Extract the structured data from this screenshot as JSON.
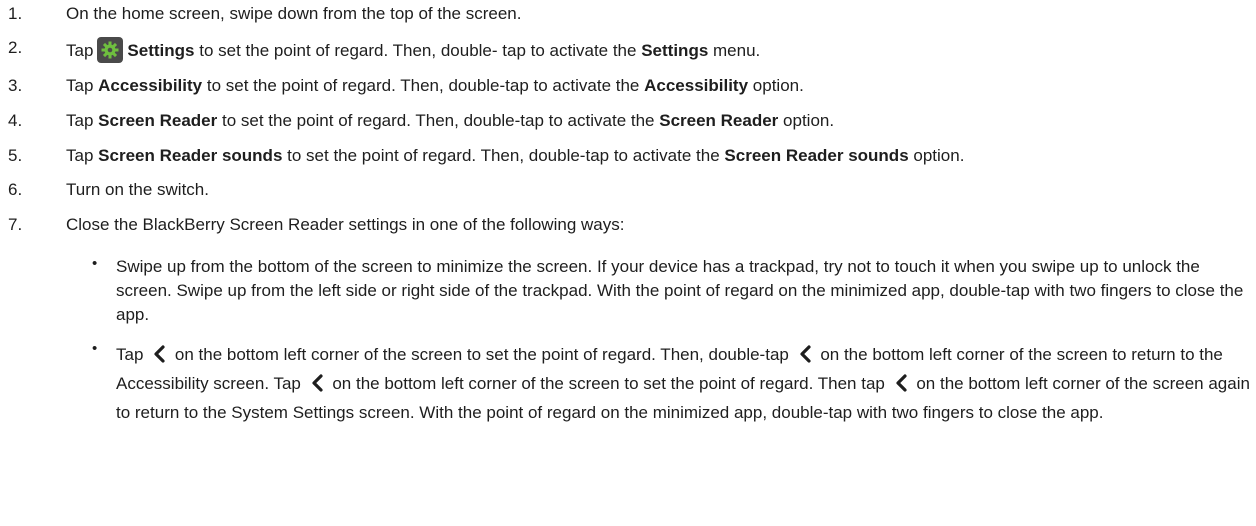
{
  "steps": [
    {
      "num": "1.",
      "text": "On the home screen, swipe down from the top of the screen."
    },
    {
      "num": "2.",
      "t1": "Tap",
      "b1": "Settings",
      "t2": "to set the point of regard. Then, double- tap to activate the",
      "b2": "Settings",
      "t3": "menu."
    },
    {
      "num": "3.",
      "t1": "Tap",
      "b1": "Accessibility",
      "t2": "to set the point of regard. Then, double-tap to activate the",
      "b2": "Accessibility",
      "t3": "option."
    },
    {
      "num": "4.",
      "t1": "Tap",
      "b1": "Screen Reader",
      "t2": "to set the point of regard. Then, double-tap to activate the",
      "b2": "Screen Reader",
      "t3": "option."
    },
    {
      "num": "5.",
      "t1": "Tap",
      "b1": "Screen Reader sounds",
      "t2": "to set the point of regard. Then, double-tap to activate the",
      "b2": "Screen Reader sounds",
      "t3": "option."
    },
    {
      "num": "6.",
      "text": "Turn on the switch."
    },
    {
      "num": "7.",
      "text": "Close the BlackBerry Screen Reader settings in one of the following ways:"
    }
  ],
  "bullets": {
    "marker": "•",
    "b1": "Swipe up from the bottom of the screen to minimize the screen. If your device has a trackpad, try not to touch it when you swipe up to unlock the screen. Swipe up from the left side or right side of the trackpad. With the point of regard on the minimized app, double-tap with two fingers to close the app.",
    "b2": {
      "p1": "Tap",
      "p2": "on the bottom left corner of the screen to set the point of regard. Then, double-tap",
      "p3": "on the bottom left corner of the screen to return to the Accessibility screen. Tap",
      "p4": "on the bottom left corner of the screen to set the point of regard. Then tap",
      "p5": "on the bottom left corner of the screen again to return to the System Settings screen. With the point of regard on the minimized app, double-tap with two fingers to close the app."
    }
  },
  "icons": {
    "settings": "gear-icon",
    "back": "chevron-left-icon"
  },
  "colors": {
    "text": "#1e1e1e",
    "icon_bg": "#4a4a4a",
    "icon_fg": "#6fbf3f"
  }
}
